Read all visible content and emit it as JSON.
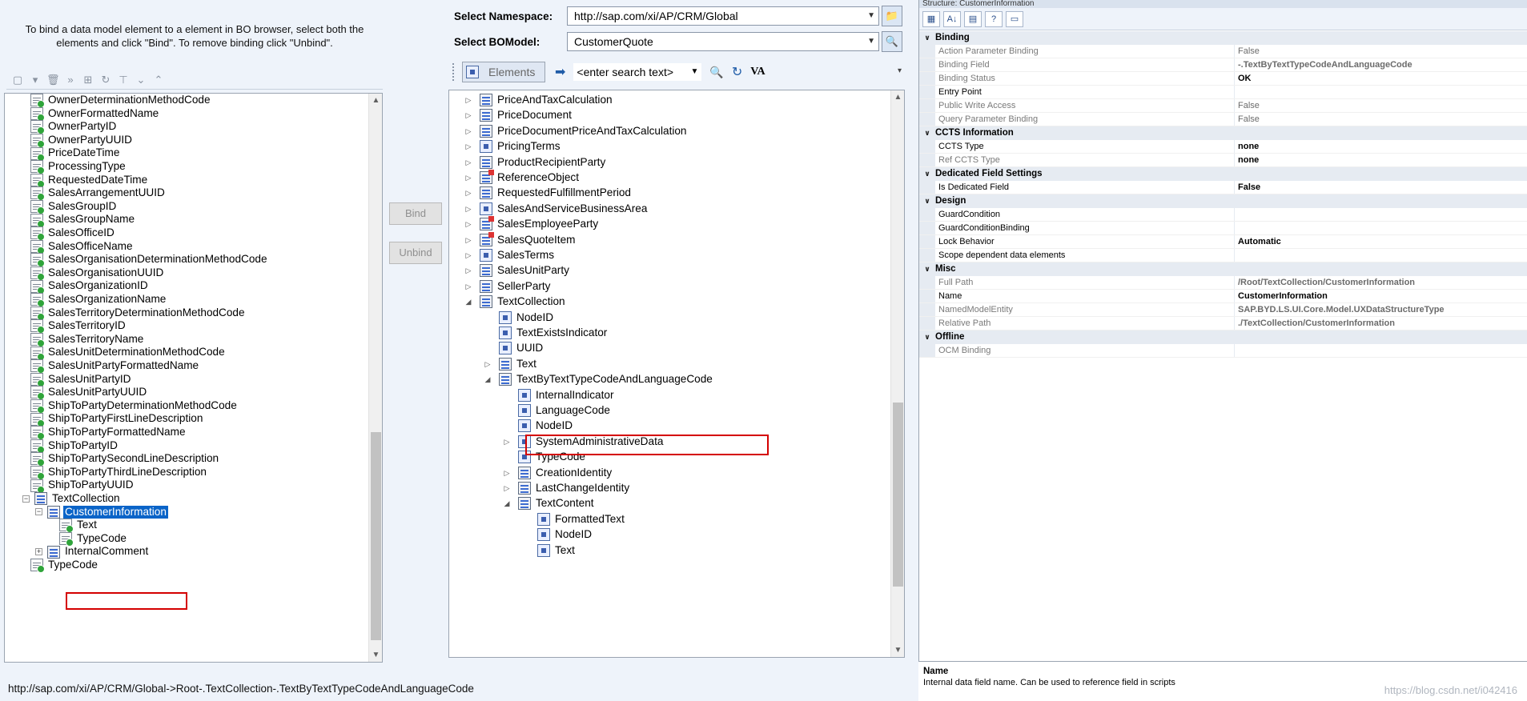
{
  "hint": "To bind a data model element to a element in BO browser, select both the elements and click \"Bind\". To remove binding click \"Unbind\".",
  "buttons": {
    "bind": "Bind",
    "unbind": "Unbind"
  },
  "namespace": {
    "label": "Select Namespace:",
    "value": "http://sap.com/xi/AP/CRM/Global"
  },
  "bomodel": {
    "label": "Select BOModel:",
    "value": "CustomerQuote"
  },
  "mid_toolbar": {
    "elements_label": "Elements",
    "search_placeholder": "<enter search text>",
    "va_label": "VA"
  },
  "left_tree": [
    {
      "label": "OwnerDeterminationMethodCode"
    },
    {
      "label": "OwnerFormattedName"
    },
    {
      "label": "OwnerPartyID"
    },
    {
      "label": "OwnerPartyUUID"
    },
    {
      "label": "PriceDateTime"
    },
    {
      "label": "ProcessingType"
    },
    {
      "label": "RequestedDateTime"
    },
    {
      "label": "SalesArrangementUUID"
    },
    {
      "label": "SalesGroupID"
    },
    {
      "label": "SalesGroupName"
    },
    {
      "label": "SalesOfficeID"
    },
    {
      "label": "SalesOfficeName"
    },
    {
      "label": "SalesOrganisationDeterminationMethodCode"
    },
    {
      "label": "SalesOrganisationUUID"
    },
    {
      "label": "SalesOrganizationID"
    },
    {
      "label": "SalesOrganizationName"
    },
    {
      "label": "SalesTerritoryDeterminationMethodCode"
    },
    {
      "label": "SalesTerritoryID"
    },
    {
      "label": "SalesTerritoryName"
    },
    {
      "label": "SalesUnitDeterminationMethodCode"
    },
    {
      "label": "SalesUnitPartyFormattedName"
    },
    {
      "label": "SalesUnitPartyID"
    },
    {
      "label": "SalesUnitPartyUUID"
    },
    {
      "label": "ShipToPartyDeterminationMethodCode"
    },
    {
      "label": "ShipToPartyFirstLineDescription"
    },
    {
      "label": "ShipToPartyFormattedName"
    },
    {
      "label": "ShipToPartyID"
    },
    {
      "label": "ShipToPartySecondLineDescription"
    },
    {
      "label": "ShipToPartyThirdLineDescription"
    },
    {
      "label": "ShipToPartyUUID"
    },
    {
      "label": "TextCollection"
    },
    {
      "label": "CustomerInformation"
    },
    {
      "label": "Text"
    },
    {
      "label": "TypeCode"
    },
    {
      "label": "InternalComment"
    },
    {
      "label": "TypeCode"
    }
  ],
  "mid_tree": [
    {
      "label": "PriceAndTaxCalculation"
    },
    {
      "label": "PriceDocument"
    },
    {
      "label": "PriceDocumentPriceAndTaxCalculation"
    },
    {
      "label": "PricingTerms"
    },
    {
      "label": "ProductRecipientParty"
    },
    {
      "label": "ReferenceObject"
    },
    {
      "label": "RequestedFulfillmentPeriod"
    },
    {
      "label": "SalesAndServiceBusinessArea"
    },
    {
      "label": "SalesEmployeeParty"
    },
    {
      "label": "SalesQuoteItem"
    },
    {
      "label": "SalesTerms"
    },
    {
      "label": "SalesUnitParty"
    },
    {
      "label": "SellerParty"
    },
    {
      "label": "TextCollection"
    },
    {
      "label": "NodeID"
    },
    {
      "label": "TextExistsIndicator"
    },
    {
      "label": "UUID"
    },
    {
      "label": "Text"
    },
    {
      "label": "TextByTextTypeCodeAndLanguageCode"
    },
    {
      "label": "InternalIndicator"
    },
    {
      "label": "LanguageCode"
    },
    {
      "label": "NodeID"
    },
    {
      "label": "SystemAdministrativeData"
    },
    {
      "label": "TypeCode"
    },
    {
      "label": "CreationIdentity"
    },
    {
      "label": "LastChangeIdentity"
    },
    {
      "label": "TextContent"
    },
    {
      "label": "FormattedText"
    },
    {
      "label": "NodeID"
    },
    {
      "label": "Text"
    }
  ],
  "props": {
    "title": "Structure: CustomerInformation",
    "categories": [
      {
        "name": "Binding",
        "rows": [
          {
            "name": "Action Parameter Binding",
            "value": "False"
          },
          {
            "name": "Binding Field",
            "value": "-.TextByTextTypeCodeAndLanguageCode"
          },
          {
            "name": "Binding Status",
            "value": "OK"
          },
          {
            "name": "Entry Point",
            "value": ""
          },
          {
            "name": "Public Write Access",
            "value": "False"
          },
          {
            "name": "Query Parameter Binding",
            "value": "False"
          }
        ]
      },
      {
        "name": "CCTS Information",
        "rows": [
          {
            "name": "CCTS Type",
            "value": "none"
          },
          {
            "name": "Ref CCTS Type",
            "value": "none"
          }
        ]
      },
      {
        "name": "Dedicated Field Settings",
        "rows": [
          {
            "name": "Is Dedicated Field",
            "value": "False"
          }
        ]
      },
      {
        "name": "Design",
        "rows": [
          {
            "name": "GuardCondition",
            "value": ""
          },
          {
            "name": "GuardConditionBinding",
            "value": ""
          },
          {
            "name": "Lock Behavior",
            "value": "Automatic"
          },
          {
            "name": "Scope dependent data elements",
            "value": ""
          }
        ]
      },
      {
        "name": "Misc",
        "rows": [
          {
            "name": "Full Path",
            "value": "/Root/TextCollection/CustomerInformation"
          },
          {
            "name": "Name",
            "value": "CustomerInformation"
          },
          {
            "name": "NamedModelEntity",
            "value": "SAP.BYD.LS.UI.Core.Model.UXDataStructureType"
          },
          {
            "name": "Relative Path",
            "value": "./TextCollection/CustomerInformation"
          }
        ]
      },
      {
        "name": "Offline",
        "rows": [
          {
            "name": "OCM Binding",
            "value": ""
          }
        ]
      }
    ]
  },
  "description": {
    "title": "Name",
    "text": "Internal data field name. Can be used to reference field in scripts"
  },
  "status_path": "http://sap.com/xi/AP/CRM/Global->Root-.TextCollection-.TextByTextTypeCodeAndLanguageCode",
  "watermark": "https://blog.csdn.net/i042416"
}
